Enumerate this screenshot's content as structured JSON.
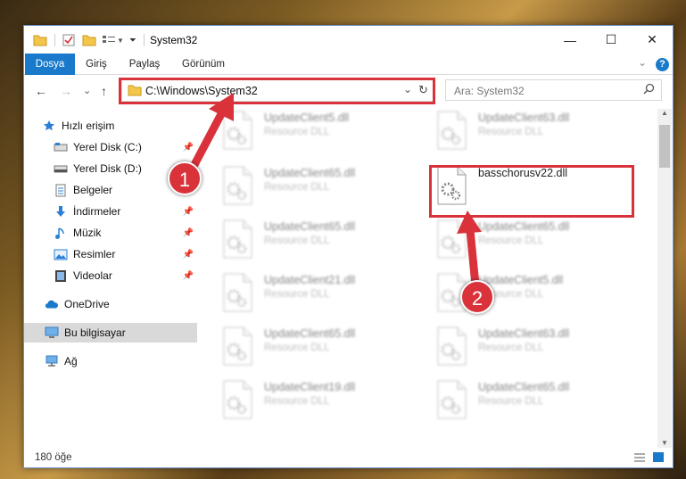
{
  "window": {
    "title": "System32",
    "controls": {
      "minimize": "—",
      "maximize": "☐",
      "close": "✕"
    }
  },
  "ribbon": {
    "tabs": [
      {
        "label": "Dosya",
        "active": true
      },
      {
        "label": "Giriş",
        "active": false
      },
      {
        "label": "Paylaş",
        "active": false
      },
      {
        "label": "Görünüm",
        "active": false
      }
    ],
    "help": "?",
    "expand": "⌄"
  },
  "nav": {
    "back": "←",
    "forward": "→",
    "recent": "⌄",
    "up": "↑",
    "address": "C:\\Windows\\System32",
    "dropdown": "⌄",
    "refresh": "↻",
    "search_placeholder": "Ara: System32"
  },
  "sidebar": {
    "items": [
      {
        "label": "Hızlı erişim",
        "icon": "star-icon",
        "pinned": false,
        "selected": false
      },
      {
        "label": "Yerel Disk (C:)",
        "icon": "drive-icon",
        "pinned": true,
        "selected": false
      },
      {
        "label": "Yerel Disk (D:)",
        "icon": "drive-icon",
        "pinned": true,
        "selected": false
      },
      {
        "label": "Belgeler",
        "icon": "document-icon",
        "pinned": true,
        "selected": false
      },
      {
        "label": "İndirmeler",
        "icon": "download-icon",
        "pinned": true,
        "selected": false
      },
      {
        "label": "Müzik",
        "icon": "music-icon",
        "pinned": true,
        "selected": false
      },
      {
        "label": "Resimler",
        "icon": "picture-icon",
        "pinned": true,
        "selected": false
      },
      {
        "label": "Videolar",
        "icon": "video-icon",
        "pinned": true,
        "selected": false
      },
      {
        "label": "OneDrive",
        "icon": "cloud-icon",
        "pinned": false,
        "selected": false
      },
      {
        "label": "Bu bilgisayar",
        "icon": "computer-icon",
        "pinned": false,
        "selected": true
      },
      {
        "label": "Ağ",
        "icon": "network-icon",
        "pinned": false,
        "selected": false
      }
    ]
  },
  "files": [
    {
      "name": "UpdateClient5.dll",
      "type": "Resource DLL",
      "blurred": true
    },
    {
      "name": "UpdateClient63.dll",
      "type": "Resource DLL",
      "blurred": true
    },
    {
      "name": "UpdateClient65.dll",
      "type": "Resource DLL",
      "blurred": true
    },
    {
      "name": "basschorusv22.dll",
      "type": "",
      "blurred": false,
      "highlighted": true
    },
    {
      "name": "UpdateClient65.dll",
      "type": "Resource DLL",
      "blurred": true
    },
    {
      "name": "UpdateClient65.dll",
      "type": "Resource DLL",
      "blurred": true
    },
    {
      "name": "UpdateClient21.dll",
      "type": "Resource DLL",
      "blurred": true
    },
    {
      "name": "UpdateClient5.dll",
      "type": "Resource DLL",
      "blurred": true
    },
    {
      "name": "UpdateClient65.dll",
      "type": "Resource DLL",
      "blurred": true
    },
    {
      "name": "UpdateClient63.dll",
      "type": "Resource DLL",
      "blurred": true
    },
    {
      "name": "UpdateClient19.dll",
      "type": "Resource DLL",
      "blurred": true
    },
    {
      "name": "UpdateClient65.dll",
      "type": "Resource DLL",
      "blurred": true
    }
  ],
  "status": {
    "count": "180 öğe"
  },
  "annotations": {
    "step1": "1",
    "step2": "2",
    "color": "#d9323a"
  }
}
